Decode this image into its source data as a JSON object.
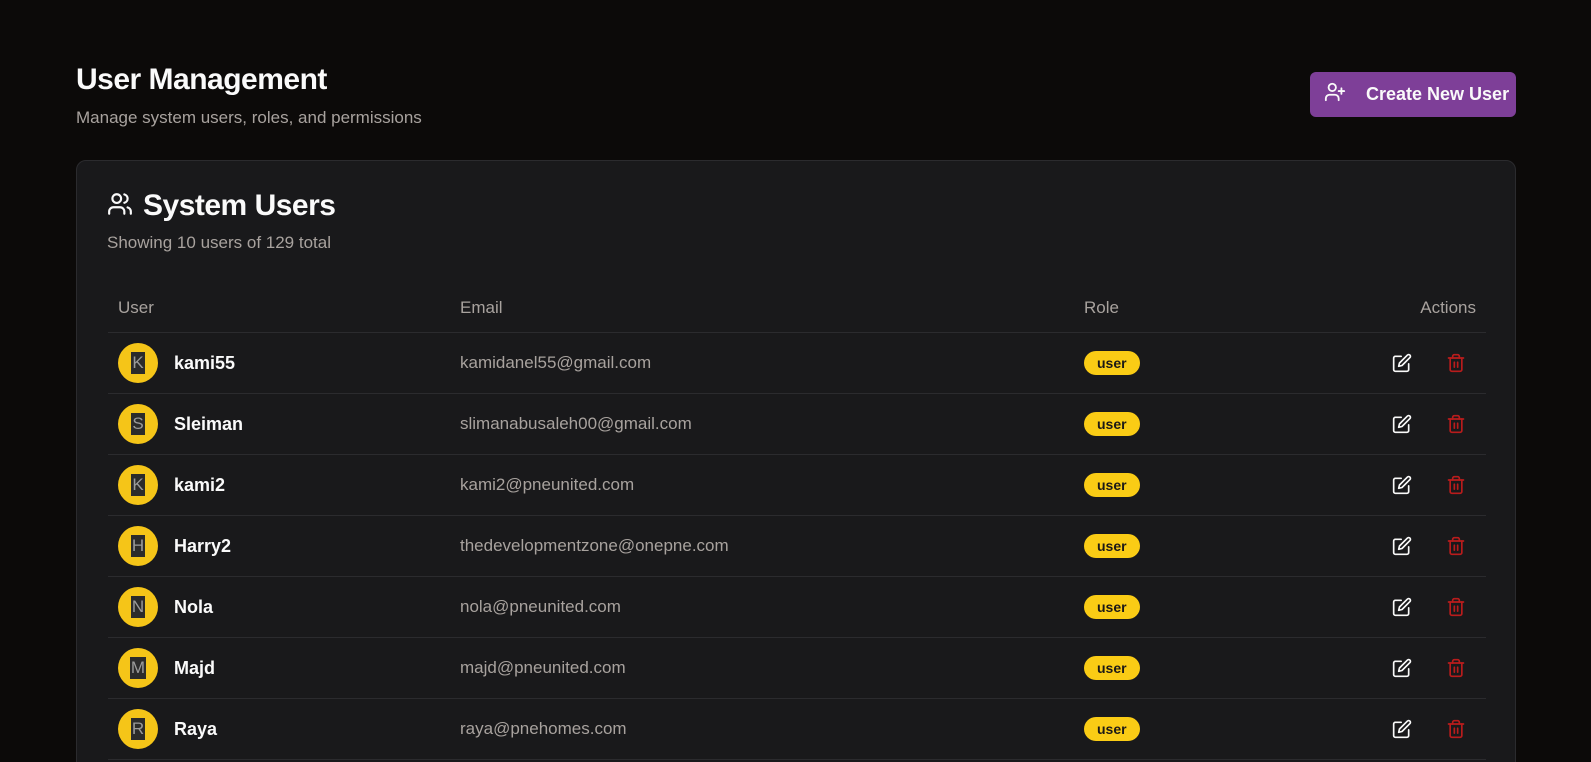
{
  "header": {
    "title": "User Management",
    "subtitle": "Manage system users, roles, and permissions",
    "create_button": "Create New User"
  },
  "card": {
    "title": "System Users",
    "description": "Showing 10 users of 129 total"
  },
  "table": {
    "columns": [
      "User",
      "Email",
      "Role",
      "Actions"
    ],
    "rows": [
      {
        "initial": "K",
        "name": "kami55",
        "email": "kamidanel55@gmail.com",
        "role": "user"
      },
      {
        "initial": "S",
        "name": "Sleiman",
        "email": "slimanabusaleh00@gmail.com",
        "role": "user"
      },
      {
        "initial": "K",
        "name": "kami2",
        "email": "kami2@pneunited.com",
        "role": "user"
      },
      {
        "initial": "H",
        "name": "Harry2",
        "email": "thedevelopmentzone@onepne.com",
        "role": "user"
      },
      {
        "initial": "N",
        "name": "Nola",
        "email": "nola@pneunited.com",
        "role": "user"
      },
      {
        "initial": "M",
        "name": "Majd",
        "email": "majd@pneunited.com",
        "role": "user"
      },
      {
        "initial": "R",
        "name": "Raya",
        "email": "raya@pnehomes.com",
        "role": "user"
      }
    ]
  },
  "icons": {
    "create": "user-plus-icon",
    "card": "users-icon",
    "edit": "edit-icon",
    "delete": "trash-icon"
  },
  "colors": {
    "accent": "#7e3f98",
    "avatar": "#f5c518",
    "badge": "#facc15",
    "delete": "#b91c1c"
  }
}
